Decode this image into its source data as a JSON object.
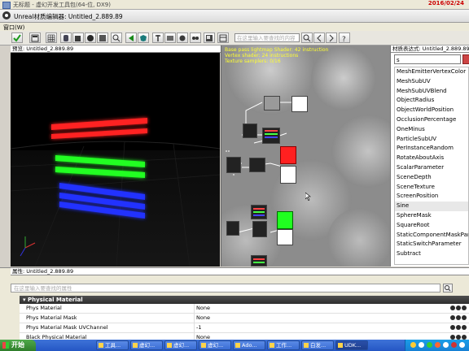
{
  "outer_window": {
    "title": "无标题 - 虚幻开发工具包(64-位, DX9)",
    "date": "2016/02/24"
  },
  "editor": {
    "title": "Unreal材质编辑器: Untitled_2.889.89"
  },
  "menu": {
    "window": "窗口(W)"
  },
  "toolbar": {
    "search_placeholder": "在这里输入要查找的内容"
  },
  "preview": {
    "title": "预览: Untitled_2.889.89"
  },
  "graph": {
    "stats": [
      "Base pass lightmap Shader: 42 instruction",
      "Vertex shader: 24 instructions",
      "Texture samplers: 0/16"
    ]
  },
  "expressions": {
    "title": "材质表达式: Untitled_2.889.89",
    "search_value": "s",
    "items": [
      "MeshEmitterVertexColor",
      "MeshSubUV",
      "MeshSubUVBlend",
      "ObjectRadius",
      "ObjectWorldPosition",
      "OcclusionPercentage",
      "OneMinus",
      "ParticleSubUV",
      "PerInstanceRandom",
      "RotateAboutAxis",
      "ScalarParameter",
      "SceneDepth",
      "SceneTexture",
      "ScreenPosition",
      "Sine",
      "SphereMask",
      "SquareRoot",
      "StaticComponentMaskParam",
      "StaticSwitchParameter",
      "Subtract"
    ],
    "selected": "Sine"
  },
  "properties": {
    "title": "属性: Untitled_2.889.89",
    "search_placeholder": "在这里输入要查找的属性",
    "category": "Physical Material",
    "rows": [
      {
        "name": "Phys Material",
        "value": "None"
      },
      {
        "name": "Phys Material Mask",
        "value": "None"
      },
      {
        "name": "Phys Material Mask UVChannel",
        "value": "-1"
      },
      {
        "name": "Black Physical Material",
        "value": "None"
      }
    ]
  },
  "taskbar": {
    "start": "开始",
    "tasks": [
      "工具...",
      "虚幻...",
      "虚幻...",
      "虚幻...",
      "Ado...",
      "工作...",
      "白发...",
      "UDK..."
    ],
    "active_index": 7
  },
  "colors": {
    "red": "#ff2020",
    "green": "#20ff20",
    "blue": "#2030ff",
    "accent": "#ffff30"
  }
}
